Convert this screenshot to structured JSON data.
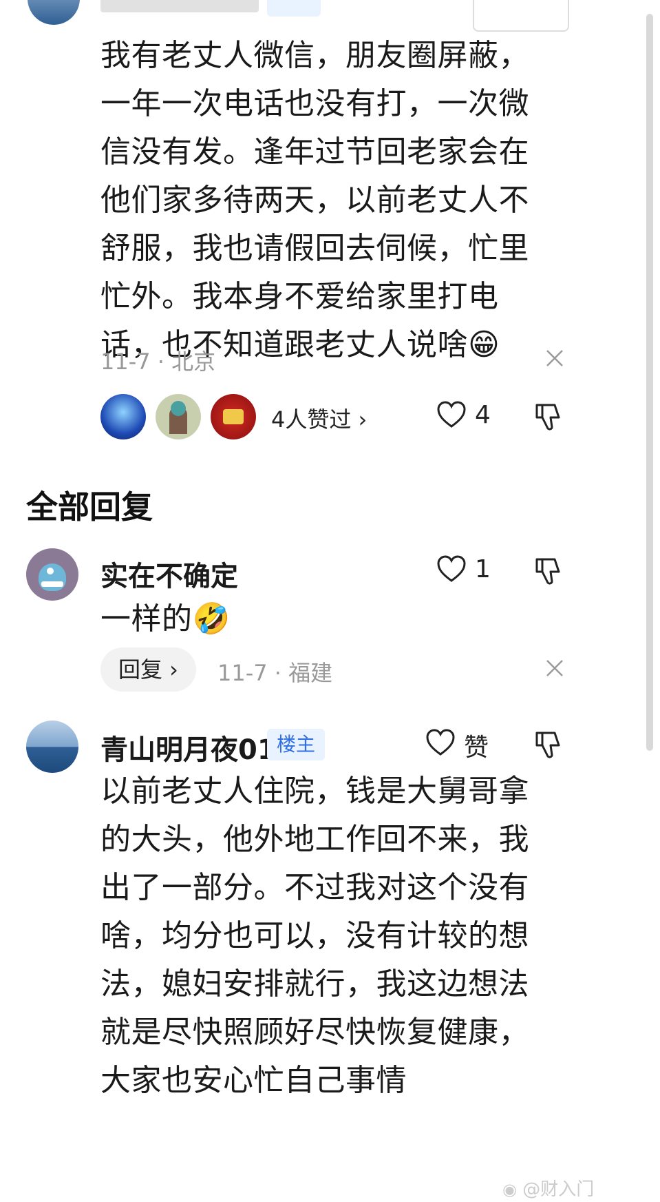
{
  "top_comment": {
    "body": "我有老丈人微信，朋友圈屏蔽，一年一次电话也没有打，一次微信没有发。逢年过节回老家会在他们家多待两天，以前老丈人不舒服，我也请假回去伺候，忙里忙外。我本身不爱给家里打电话，也不知道跟老丈人说啥",
    "emoji": "😁",
    "meta": "11-7 · 北京",
    "likers_text": "4人赞过 ›",
    "like_count": "4"
  },
  "section_title": "全部回复",
  "replies": [
    {
      "name": "实在不确定",
      "body": "一样的",
      "emoji": "🤣",
      "reply_label": "回复 ›",
      "meta": "11-7 · 福建",
      "like_count": "1"
    },
    {
      "name": "青山明月夜01",
      "badge": "楼主",
      "body": "以前老丈人住院，钱是大舅哥拿的大头，他外地工作回不来，我出了一部分。不过我对这个没有啥，均分也可以，没有计较的想法，媳妇安排就行，我这边想法就是尽快照顾好尽快恢复健康，大家也安心忙自己事情",
      "like_label": "赞"
    }
  ],
  "watermark": "@财入门",
  "colors": {
    "badge_bg": "#e9f2ff",
    "badge_text": "#2f6fe4",
    "meta": "#999999"
  },
  "icons": [
    "heart-icon",
    "dislike-icon",
    "close-icon",
    "weibo-icon"
  ]
}
